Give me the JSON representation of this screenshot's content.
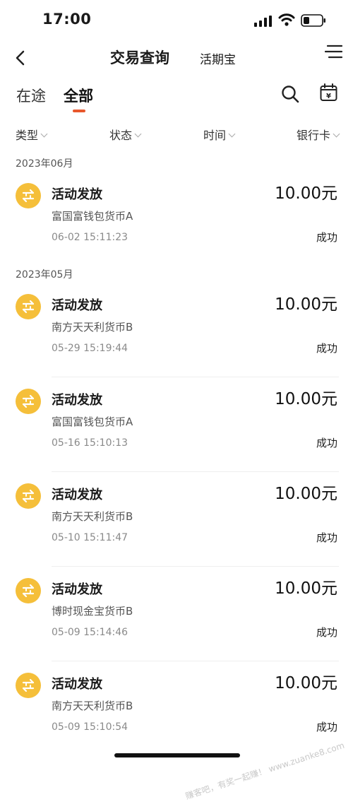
{
  "status_bar": {
    "time": "17:00"
  },
  "nav": {
    "title": "交易查询",
    "subtitle": "活期宝"
  },
  "tabs": [
    {
      "label": "在途"
    },
    {
      "label": "全部"
    }
  ],
  "colors": {
    "accent": "#e8572c",
    "icon_bg": "#f5bf3a",
    "text": "#1a1a1a"
  },
  "icons": {
    "search": "search-icon",
    "calendar": "calendar-icon",
    "menu": "menu-icon",
    "back": "chevron-left-icon"
  },
  "calendar_icon_glyph": "¥",
  "filters": [
    {
      "label": "类型"
    },
    {
      "label": "状态"
    },
    {
      "label": "时间"
    },
    {
      "label": "银行卡"
    }
  ],
  "groups": [
    {
      "month": "2023年06月",
      "items": [
        {
          "title": "活动发放",
          "fund": "富国富钱包货币A",
          "date": "06-02 15:11:23",
          "amount": "10.00元",
          "status": "成功"
        }
      ]
    },
    {
      "month": "2023年05月",
      "items": [
        {
          "title": "活动发放",
          "fund": "南方天天利货币B",
          "date": "05-29 15:19:44",
          "amount": "10.00元",
          "status": "成功"
        },
        {
          "title": "活动发放",
          "fund": "富国富钱包货币A",
          "date": "05-16 15:10:13",
          "amount": "10.00元",
          "status": "成功"
        },
        {
          "title": "活动发放",
          "fund": "南方天天利货币B",
          "date": "05-10 15:11:47",
          "amount": "10.00元",
          "status": "成功"
        },
        {
          "title": "活动发放",
          "fund": "博时现金宝货币B",
          "date": "05-09 15:14:46",
          "amount": "10.00元",
          "status": "成功"
        },
        {
          "title": "活动发放",
          "fund": "南方天天利货币B",
          "date": "05-09 15:10:54",
          "amount": "10.00元",
          "status": "成功"
        }
      ]
    }
  ],
  "watermark": "赚客吧，有奖一起赚！ www.zuanke8.com"
}
